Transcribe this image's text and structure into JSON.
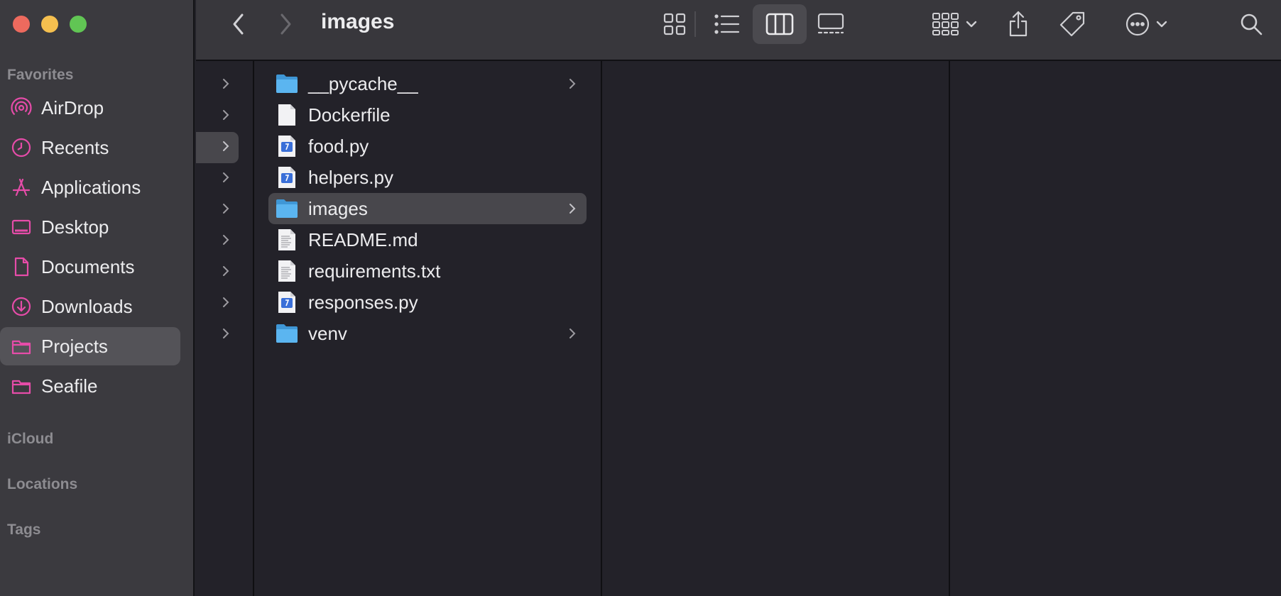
{
  "window": {
    "title": "images"
  },
  "colors": {
    "accent": "#e64ca9",
    "folder": "#5bb5f0",
    "close": "#ed6a5e",
    "minimize": "#f5bf4f",
    "zoom": "#61c554"
  },
  "sidebar": {
    "favorites_title": "Favorites",
    "items": [
      {
        "label": "AirDrop",
        "icon": "airdrop-icon"
      },
      {
        "label": "Recents",
        "icon": "clock-icon"
      },
      {
        "label": "Applications",
        "icon": "applications-icon"
      },
      {
        "label": "Desktop",
        "icon": "desktop-icon"
      },
      {
        "label": "Documents",
        "icon": "document-icon"
      },
      {
        "label": "Downloads",
        "icon": "download-icon"
      },
      {
        "label": "Projects",
        "icon": "folder-icon",
        "selected": true
      },
      {
        "label": "Seafile",
        "icon": "folder-icon"
      }
    ],
    "icloud_title": "iCloud",
    "locations_title": "Locations",
    "tags_title": "Tags"
  },
  "toolbar": {
    "back": "back-chevron-icon",
    "forward": "forward-chevron-icon",
    "view_modes": [
      "icon-view-icon",
      "list-view-icon",
      "column-view-icon",
      "gallery-view-icon"
    ],
    "active_view": "column-view-icon",
    "group": "group-icon",
    "share": "share-icon",
    "tags": "tag-icon",
    "more": "more-icon",
    "search": "search-icon"
  },
  "files": [
    {
      "name": "__pycache__",
      "type": "folder"
    },
    {
      "name": "Dockerfile",
      "type": "doc"
    },
    {
      "name": "food.py",
      "type": "python"
    },
    {
      "name": "helpers.py",
      "type": "python"
    },
    {
      "name": "images",
      "type": "folder",
      "selected": true
    },
    {
      "name": "README.md",
      "type": "text"
    },
    {
      "name": "requirements.txt",
      "type": "text"
    },
    {
      "name": "responses.py",
      "type": "python"
    },
    {
      "name": "venv",
      "type": "folder"
    }
  ]
}
